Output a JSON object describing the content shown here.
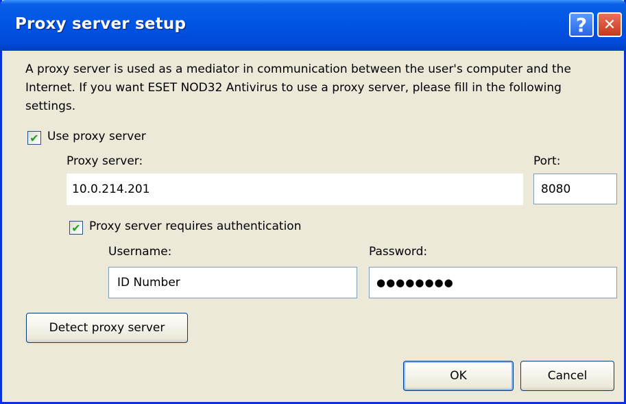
{
  "window": {
    "title": "Proxy server setup",
    "help_glyph": "?",
    "close_glyph": "✕"
  },
  "description": "A proxy server is used as a mediator in communication between the user's computer and the Internet. If you want ESET NOD32 Antivirus to use a proxy server, please fill in the following settings.",
  "use_proxy": {
    "label": "Use proxy server",
    "checked": true,
    "check_glyph": "✔"
  },
  "proxy_server": {
    "label": "Proxy server:",
    "value": "10.0.214.201"
  },
  "port": {
    "label": "Port:",
    "value": "8080"
  },
  "auth": {
    "label": "Proxy server requires authentication",
    "checked": true,
    "check_glyph": "✔"
  },
  "username": {
    "label": "Username:",
    "value": "ID Number"
  },
  "password": {
    "label": "Password:",
    "value": "●●●●●●●●"
  },
  "buttons": {
    "detect": "Detect proxy server",
    "ok": "OK",
    "cancel": "Cancel"
  },
  "colors": {
    "titlebar": "#0055e5",
    "dialog_bg": "#ece9d8",
    "checkmark": "#21a121",
    "field_border": "#7f9db9"
  }
}
